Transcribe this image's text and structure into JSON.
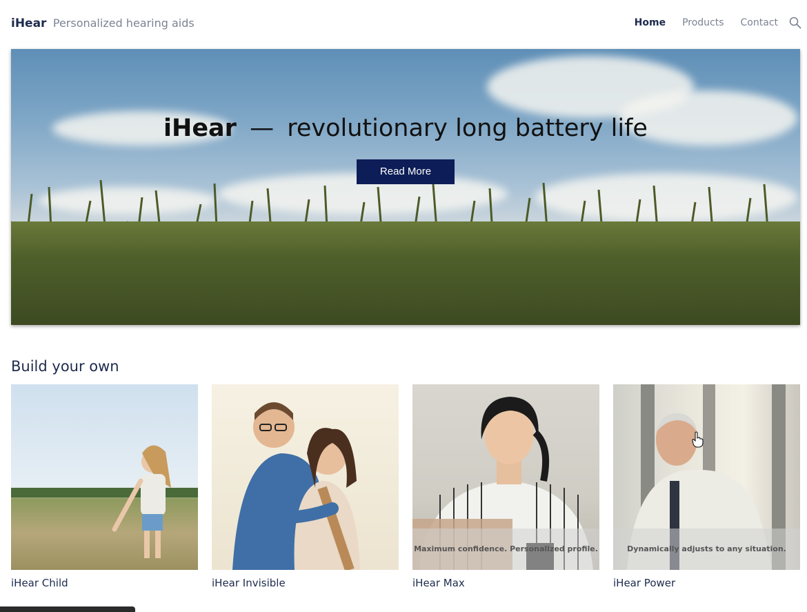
{
  "header": {
    "brand_name": "iHear",
    "brand_tagline": "Personalized hearing aids",
    "nav": [
      {
        "label": "Home",
        "active": true
      },
      {
        "label": "Products",
        "active": false
      },
      {
        "label": "Contact",
        "active": false
      }
    ],
    "search_icon": "search-icon"
  },
  "hero": {
    "brand": "iHear",
    "dash": "—",
    "headline": "revolutionary long battery life",
    "button_label": "Read More"
  },
  "section": {
    "title": "Build your own"
  },
  "products": [
    {
      "name": "iHear Child",
      "overlay": ""
    },
    {
      "name": "iHear Invisible",
      "overlay": ""
    },
    {
      "name": "iHear Max",
      "overlay": "Maximum confidence. Personalized profile."
    },
    {
      "name": "iHear Power",
      "overlay": "Dynamically adjusts to any situation."
    }
  ],
  "colors": {
    "brand_dark": "#1d2a4d",
    "button_bg": "#0d1d57",
    "muted_text": "#7b8393"
  }
}
